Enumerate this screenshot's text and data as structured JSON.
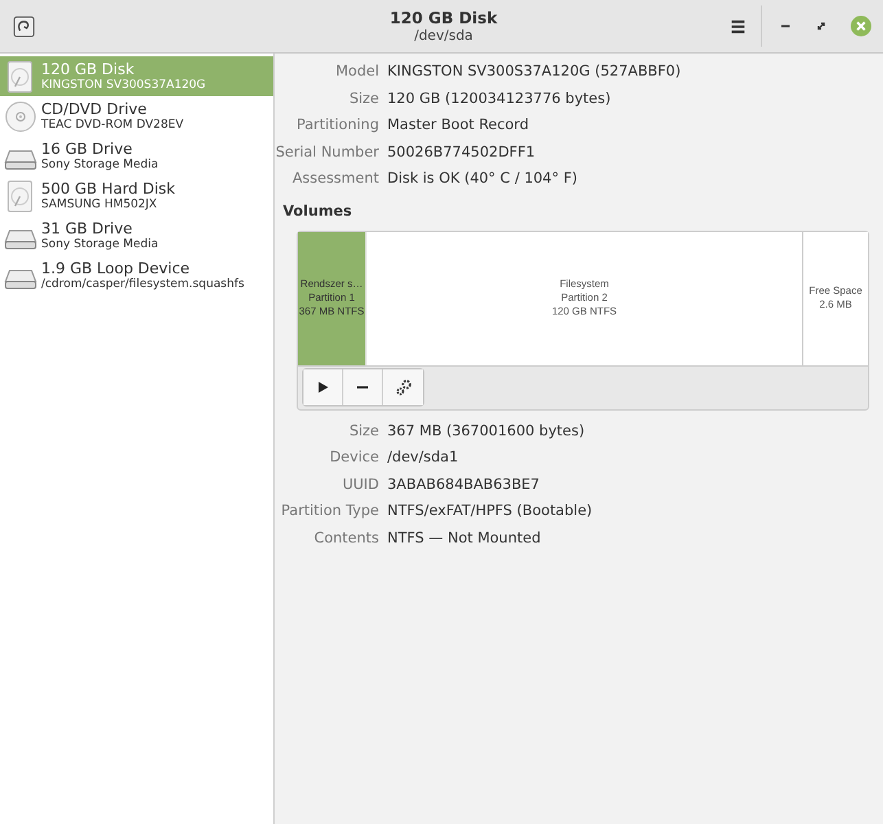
{
  "window": {
    "title": "120 GB Disk",
    "subtitle": "/dev/sda"
  },
  "devices": [
    {
      "name": "120 GB Disk",
      "detail": "KINGSTON SV300S37A120G",
      "kind": "disk",
      "selected": true
    },
    {
      "name": "CD/DVD Drive",
      "detail": "TEAC DVD-ROM DV28EV",
      "kind": "optical",
      "selected": false
    },
    {
      "name": "16 GB Drive",
      "detail": "Sony Storage Media",
      "kind": "drive",
      "selected": false
    },
    {
      "name": "500 GB Hard Disk",
      "detail": "SAMSUNG HM502JX",
      "kind": "disk",
      "selected": false
    },
    {
      "name": "31 GB Drive",
      "detail": "Sony Storage Media",
      "kind": "drive",
      "selected": false
    },
    {
      "name": "1.9 GB Loop Device",
      "detail": "/cdrom/casper/filesystem.squashfs",
      "kind": "drive",
      "selected": false
    }
  ],
  "disk_info": [
    {
      "label": "Model",
      "value": "KINGSTON SV300S37A120G (527ABBF0)"
    },
    {
      "label": "Size",
      "value": "120 GB (120034123776 bytes)"
    },
    {
      "label": "Partitioning",
      "value": "Master Boot Record"
    },
    {
      "label": "Serial Number",
      "value": "50026B774502DFF1"
    },
    {
      "label": "Assessment",
      "value": "Disk is OK (40° C / 104° F)"
    }
  ],
  "volumes": {
    "title": "Volumes",
    "partitions": [
      {
        "lines": [
          "Rendszer s…",
          "Partition 1",
          "367 MB NTFS"
        ],
        "kind": "small",
        "selected": true
      },
      {
        "lines": [
          "Filesystem",
          "Partition 2",
          "120 GB NTFS"
        ],
        "kind": "large",
        "selected": false
      },
      {
        "lines": [
          "Free Space",
          "2.6 MB"
        ],
        "kind": "free",
        "selected": false
      }
    ]
  },
  "volume_info": [
    {
      "label": "Size",
      "value": "367 MB (367001600 bytes)"
    },
    {
      "label": "Device",
      "value": "/dev/sda1"
    },
    {
      "label": "UUID",
      "value": "3ABAB684BAB63BE7"
    },
    {
      "label": "Partition Type",
      "value": "NTFS/exFAT/HPFS (Bootable)"
    },
    {
      "label": "Contents",
      "value": "NTFS — Not Mounted"
    }
  ]
}
